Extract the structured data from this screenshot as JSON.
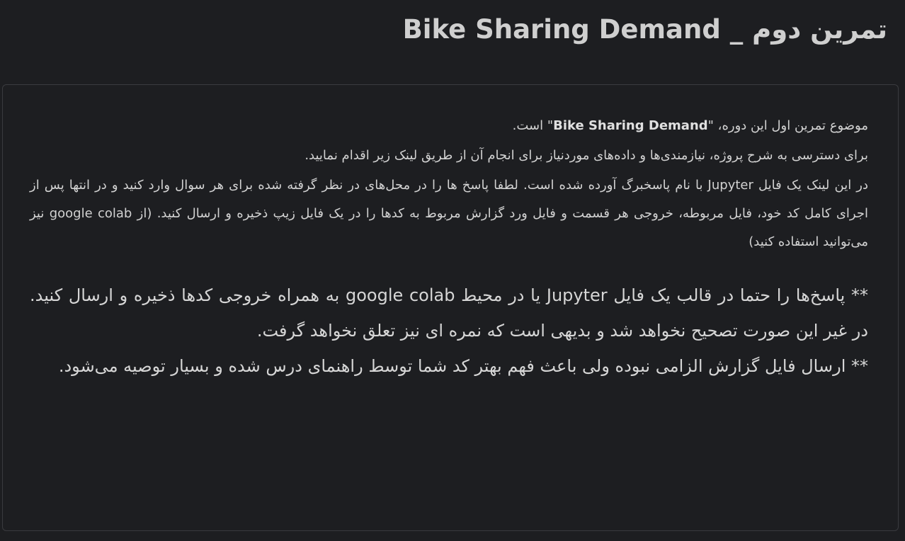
{
  "page": {
    "title": "تمرین دوم _ Bike Sharing Demand"
  },
  "content": {
    "p1_before": "موضوع تمرین اول این دوره، \"",
    "p1_bold": "Bike Sharing Demand",
    "p1_after": "\" است.",
    "p2": "برای دسترسی به شرح پروژه، نیازمندی‌ها و داده‌های موردنیاز برای انجام آن از طریق لینک زیر اقدام نمایید.",
    "p3": "در این لینک یک فایل Jupyter با نام پاسخبرگ آورده شده است. لطفا پاسخ ها را در محل‌های در نظر گرفته شده برای هر سوال وارد کنید و در انتها پس از اجرای کامل کد خود، فایل مربوطه، خروجی هر قسمت و فایل ورد گزارش مربوط به کدها را در یک فایل زیپ ذخیره و ارسال کنید. (از google colab نیز می‌توانید استفاده کنید)",
    "note1": "** پاسخ‌ها را حتما در قالب یک فایل Jupyter یا در محیط google colab به همراه خروجی کدها ذخیره و ارسال کنید. در غیر این صورت تصحیح نخواهد شد و بدیهی است که نمره ای نیز تعلق نخواهد گرفت.",
    "note2": "** ارسال فایل گزارش الزامی نبوده ولی باعث فهم بهتر کد شما توسط راهنمای درس شده و بسیار توصیه می‌شود."
  }
}
